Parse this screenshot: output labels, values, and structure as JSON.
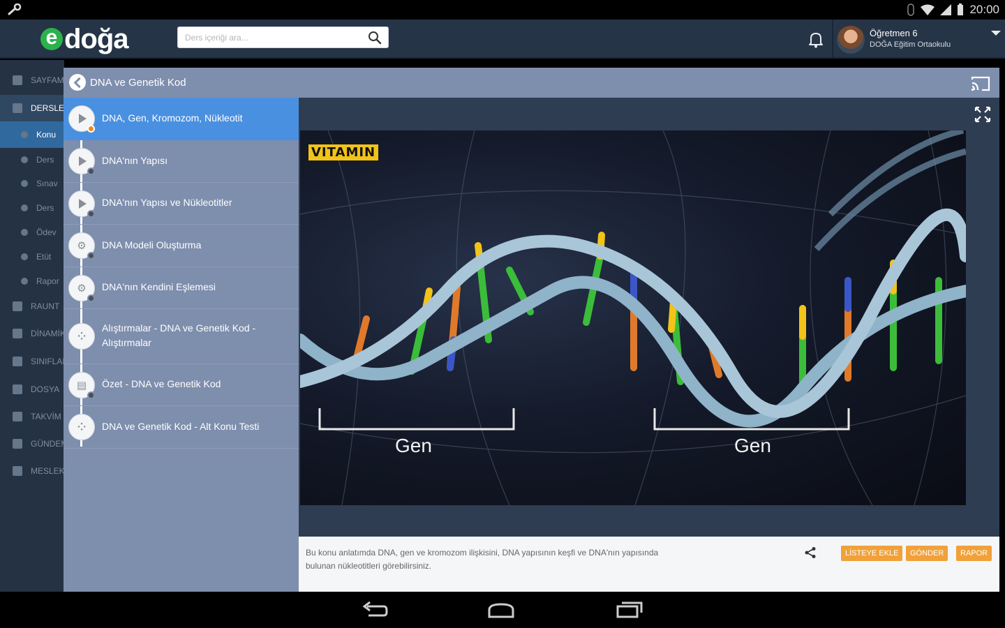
{
  "status_bar": {
    "time": "20:00"
  },
  "header": {
    "logo_e": "e",
    "logo_word": "doğa",
    "search_placeholder": "Ders içeriği ara...",
    "user_name": "Öğretmen 6",
    "user_school": "DOĞA Eğitim Ortaokulu"
  },
  "sidebar": {
    "items": [
      {
        "label": "SAYFAM"
      },
      {
        "label": "DERSLER"
      },
      {
        "label": "Konu"
      },
      {
        "label": "Ders"
      },
      {
        "label": "Sınav"
      },
      {
        "label": "Ders"
      },
      {
        "label": "Ödev"
      },
      {
        "label": "Etüt"
      },
      {
        "label": "Rapor"
      },
      {
        "label": "RAUNT"
      },
      {
        "label": "DİNAMİK"
      },
      {
        "label": "SINIFLAR"
      },
      {
        "label": "DOSYA"
      },
      {
        "label": "TAKVİM"
      },
      {
        "label": "GÜNDEM"
      },
      {
        "label": "MESLEK"
      }
    ]
  },
  "panel": {
    "title": "DNA ve Genetik Kod",
    "lessons": [
      {
        "label": "DNA, Gen, Kromozom, Nükleotit"
      },
      {
        "label": "DNA'nın Yapısı"
      },
      {
        "label": "DNA'nın Yapısı ve Nükleotitler"
      },
      {
        "label": "DNA Modeli Oluşturma"
      },
      {
        "label": "DNA'nın Kendini Eşlemesi"
      },
      {
        "label": "Alıştırmalar - DNA ve Genetik Kod - Alıştırmalar"
      },
      {
        "label": "Özet - DNA ve Genetik Kod"
      },
      {
        "label": "DNA ve Genetik Kod - Alt Konu Testi"
      }
    ],
    "video": {
      "badge": "VITAMIN",
      "gen_left": "Gen",
      "gen_right": "Gen"
    },
    "description": "Bu konu anlatımda DNA, gen ve kromozom ilişkisini, DNA yapısının keşfi ve DNA'nın yapısında bulunan nükleotitleri görebilirsiniz.",
    "buttons": {
      "add_to_list": "LİSTEYE EKLE",
      "send": "GÖNDER",
      "report": "RAPOR"
    }
  },
  "colors": {
    "header_bg": "#263447",
    "panel_list_bg": "#7e8ead",
    "active_item": "#4a90e0",
    "action_button": "#f0a13a",
    "logo_green": "#2bb24c"
  }
}
